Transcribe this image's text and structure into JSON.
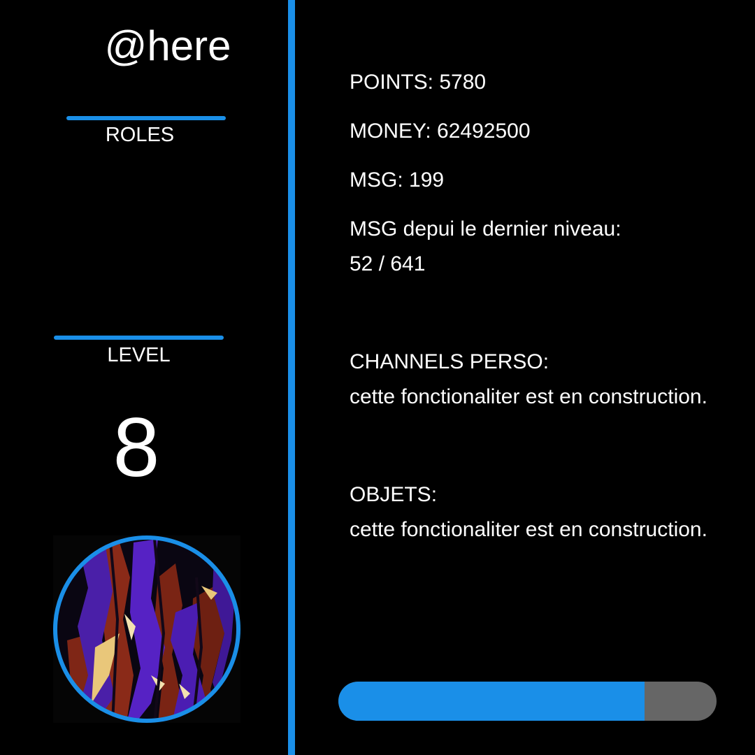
{
  "profile": {
    "username": "@here",
    "roles_heading": "ROLES",
    "level_heading": "LEVEL",
    "level": "8"
  },
  "stats": {
    "points": "POINTS: 5780",
    "money": "MONEY: 62492500",
    "msg": "MSG: 199",
    "msg_since_level_label": "MSG depui le dernier niveau:",
    "msg_since_level_value": "52 / 641"
  },
  "sections": {
    "channels_heading": "CHANNELS PERSO:",
    "channels_text": "cette fonctionaliter est en construction.",
    "objets_heading": "OBJETS:",
    "objets_text": "cette fonctionaliter est en construction."
  },
  "progress": {
    "fraction": 0.81
  },
  "colors": {
    "accent": "#1a8fe8",
    "background": "#000000",
    "text": "#ffffff",
    "progress_track": "#666666"
  },
  "icons": {
    "avatar": "avatar-image"
  }
}
